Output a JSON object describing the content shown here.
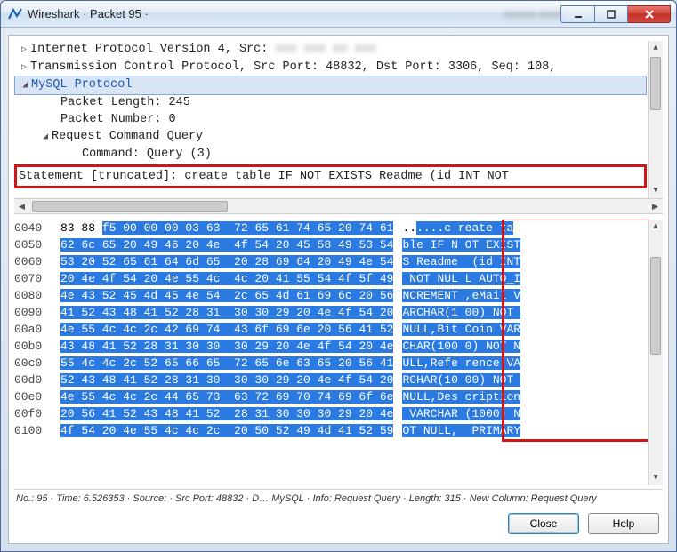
{
  "window": {
    "title": "Wireshark · Packet 95 ·"
  },
  "tree": {
    "ip": "Internet Protocol Version 4, Src:",
    "tcp": "Transmission Control Protocol, Src Port: 48832, Dst Port: 3306, Seq: 108,",
    "mysql": "MySQL Protocol",
    "pktlen": "Packet Length: 245",
    "pktnum": "Packet Number: 0",
    "reqcmd": "Request Command Query",
    "cmd": "Command: Query (3)",
    "stmt": "Statement [truncated]: create table IF NOT EXISTS Readme (id INT NOT"
  },
  "hex": {
    "rows": [
      {
        "offset": "0040",
        "pre": "83 88 ",
        "sel": "f5 00 00 00 03 63  72 65 61 74 65 20 74 61",
        "apre": "..",
        "asel": "....c reate ta"
      },
      {
        "offset": "0050",
        "pre": "",
        "sel": "62 6c 65 20 49 46 20 4e  4f 54 20 45 58 49 53 54",
        "apre": "",
        "asel": "ble IF N OT EXIST"
      },
      {
        "offset": "0060",
        "pre": "",
        "sel": "53 20 52 65 61 64 6d 65  20 28 69 64 20 49 4e 54",
        "apre": "",
        "asel": "S Readme  (id INT"
      },
      {
        "offset": "0070",
        "pre": "",
        "sel": "20 4e 4f 54 20 4e 55 4c  4c 20 41 55 54 4f 5f 49",
        "apre": "",
        "asel": " NOT NUL L AUTO_I"
      },
      {
        "offset": "0080",
        "pre": "",
        "sel": "4e 43 52 45 4d 45 4e 54  2c 65 4d 61 69 6c 20 56",
        "apre": "",
        "asel": "NCREMENT ,eMail V"
      },
      {
        "offset": "0090",
        "pre": "",
        "sel": "41 52 43 48 41 52 28 31  30 30 29 20 4e 4f 54 20",
        "apre": "",
        "asel": "ARCHAR(1 00) NOT "
      },
      {
        "offset": "00a0",
        "pre": "",
        "sel": "4e 55 4c 4c 2c 42 69 74  43 6f 69 6e 20 56 41 52",
        "apre": "",
        "asel": "NULL,Bit Coin VAR"
      },
      {
        "offset": "00b0",
        "pre": "",
        "sel": "43 48 41 52 28 31 30 30  30 29 20 4e 4f 54 20 4e",
        "apre": "",
        "asel": "CHAR(100 0) NOT N"
      },
      {
        "offset": "00c0",
        "pre": "",
        "sel": "55 4c 4c 2c 52 65 66 65  72 65 6e 63 65 20 56 41",
        "apre": "",
        "asel": "ULL,Refe rence VA"
      },
      {
        "offset": "00d0",
        "pre": "",
        "sel": "52 43 48 41 52 28 31 30  30 30 29 20 4e 4f 54 20",
        "apre": "",
        "asel": "RCHAR(10 00) NOT "
      },
      {
        "offset": "00e0",
        "pre": "",
        "sel": "4e 55 4c 4c 2c 44 65 73  63 72 69 70 74 69 6f 6e",
        "apre": "",
        "asel": "NULL,Des cription"
      },
      {
        "offset": "00f0",
        "pre": "",
        "sel": "20 56 41 52 43 48 41 52  28 31 30 30 30 29 20 4e",
        "apre": "",
        "asel": " VARCHAR (1000) N"
      },
      {
        "offset": "0100",
        "pre": "",
        "sel": "4f 54 20 4e 55 4c 4c 2c  20 50 52 49 4d 41 52 59",
        "apre": "",
        "asel": "OT NULL,  PRIMARY"
      }
    ]
  },
  "status": "No.: 95 · Time: 6.526353 · Source:             · Src Port: 48832 · D… MySQL · Info: Request Query · Length: 315 · New Column: Request Query",
  "buttons": {
    "close": "Close",
    "help": "Help"
  }
}
